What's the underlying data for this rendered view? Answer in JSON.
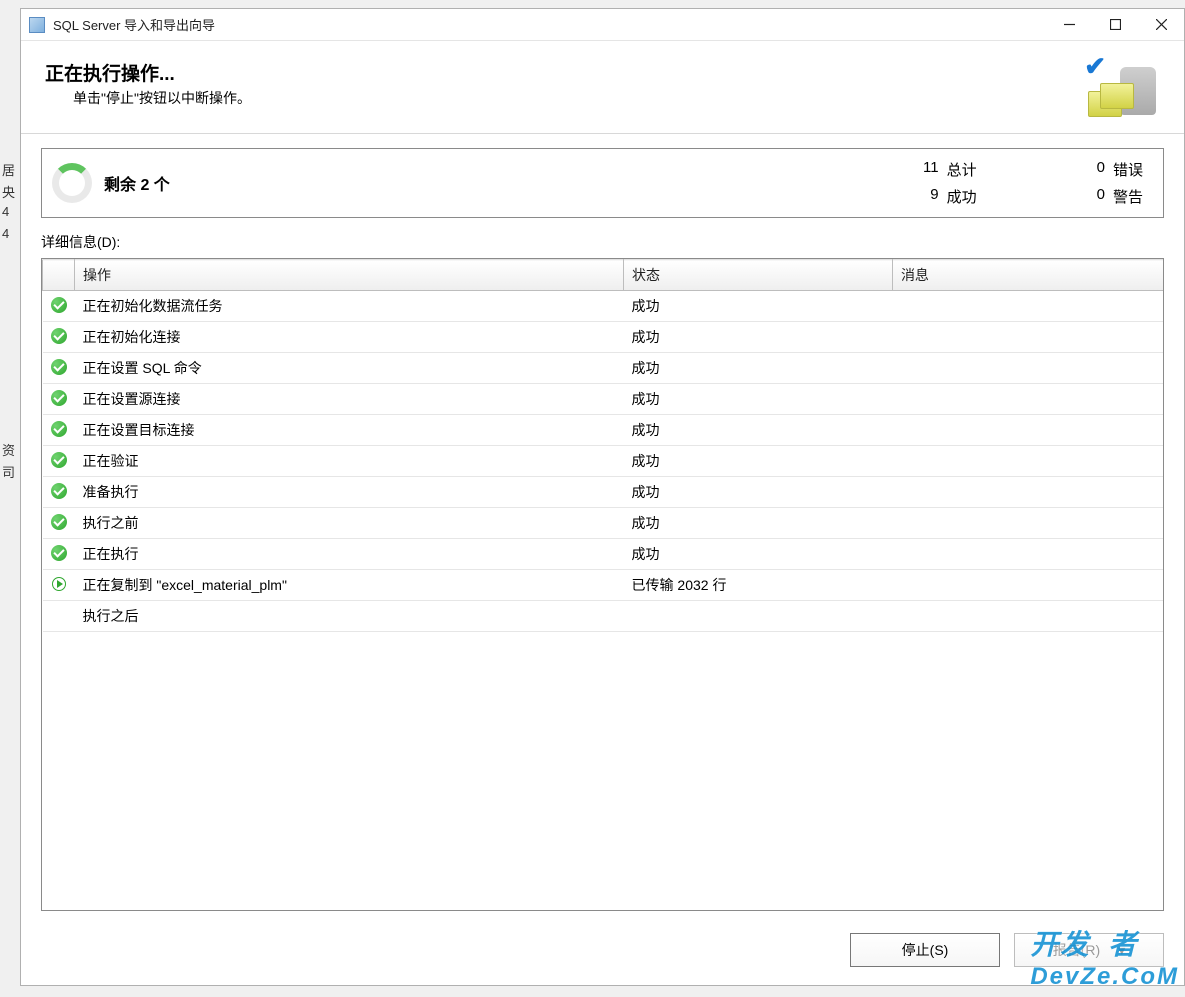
{
  "window": {
    "title": "SQL Server 导入和导出向导"
  },
  "header": {
    "title": "正在执行操作...",
    "subtitle": "单击\"停止\"按钮以中断操作。"
  },
  "summary": {
    "remaining": "剩余 2 个",
    "total_num": "11",
    "total_lbl": "总计",
    "success_num": "9",
    "success_lbl": "成功",
    "error_num": "0",
    "error_lbl": "错误",
    "warn_num": "0",
    "warn_lbl": "警告"
  },
  "details_label": "详细信息(D):",
  "columns": {
    "action": "操作",
    "status": "状态",
    "message": "消息"
  },
  "rows": [
    {
      "icon": "success",
      "action": "正在初始化数据流任务",
      "status": "成功",
      "message": ""
    },
    {
      "icon": "success",
      "action": "正在初始化连接",
      "status": "成功",
      "message": ""
    },
    {
      "icon": "success",
      "action": "正在设置 SQL 命令",
      "status": "成功",
      "message": ""
    },
    {
      "icon": "success",
      "action": "正在设置源连接",
      "status": "成功",
      "message": ""
    },
    {
      "icon": "success",
      "action": "正在设置目标连接",
      "status": "成功",
      "message": ""
    },
    {
      "icon": "success",
      "action": "正在验证",
      "status": "成功",
      "message": ""
    },
    {
      "icon": "success",
      "action": "准备执行",
      "status": "成功",
      "message": ""
    },
    {
      "icon": "success",
      "action": "执行之前",
      "status": "成功",
      "message": ""
    },
    {
      "icon": "success",
      "action": "正在执行",
      "status": "成功",
      "message": ""
    },
    {
      "icon": "running",
      "action": "正在复制到 \"excel_material_plm\"",
      "status": "已传输 2032 行",
      "message": ""
    },
    {
      "icon": "",
      "action": "执行之后",
      "status": "",
      "message": ""
    }
  ],
  "buttons": {
    "stop": "停止(S)",
    "report": "报告(R)"
  },
  "watermark": "开发 者\nDevZe.CoM"
}
